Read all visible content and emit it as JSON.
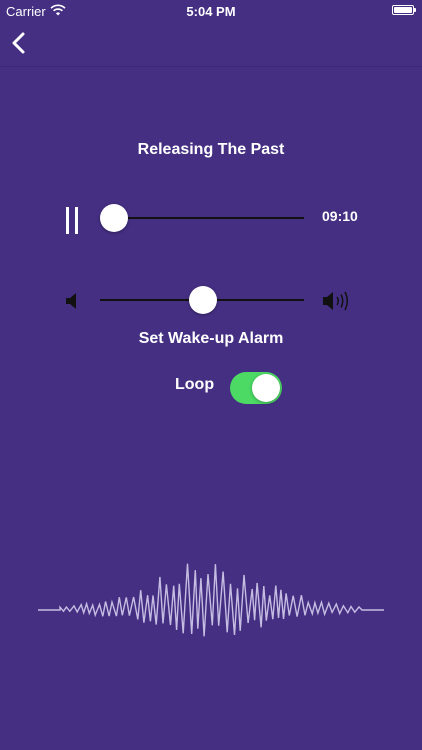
{
  "status_bar": {
    "carrier": "Carrier",
    "time": "5:04 PM"
  },
  "player": {
    "title": "Releasing The Past",
    "remaining_time": "09:10",
    "progress_fraction": 0.05,
    "volume_fraction": 0.5,
    "state": "playing"
  },
  "alarm": {
    "label": "Set Wake-up Alarm"
  },
  "loop": {
    "label": "Loop",
    "enabled": true
  },
  "colors": {
    "background": "#452f83",
    "toggle_on": "#4cd964",
    "waveform": "#c6bde3"
  },
  "icons": {
    "back": "chevron-left-icon",
    "pause": "pause-icon",
    "volume_low": "speaker-low-icon",
    "volume_high": "speaker-high-icon"
  }
}
